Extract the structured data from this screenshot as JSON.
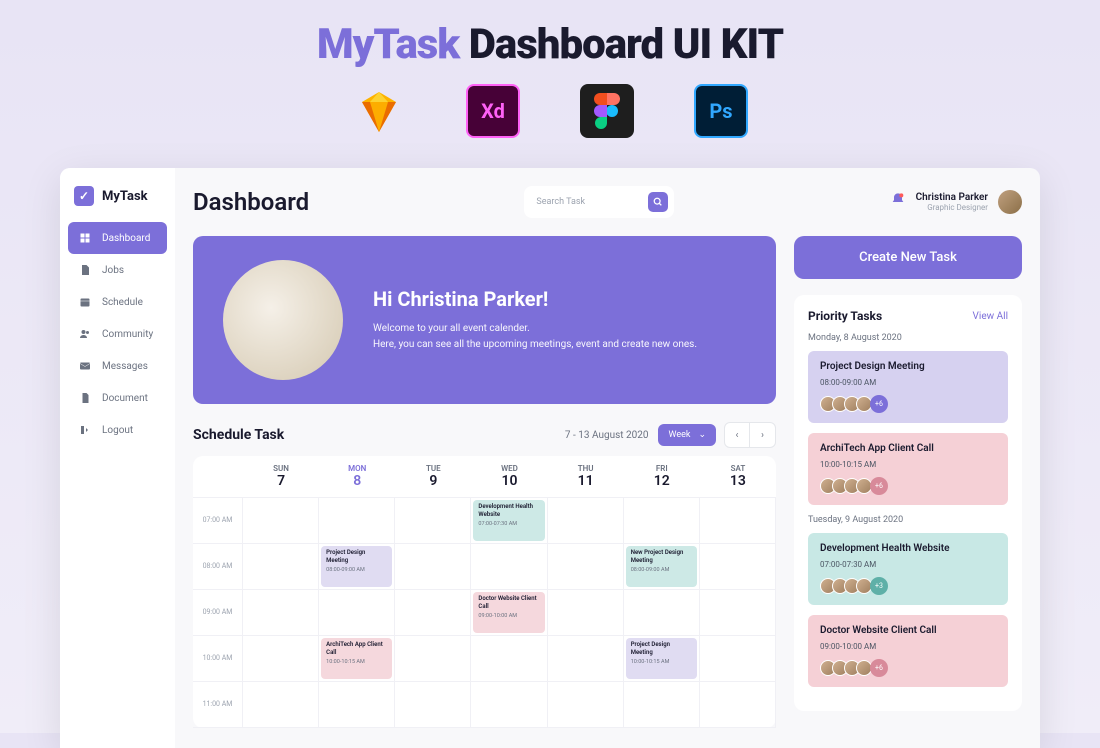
{
  "promo": {
    "brand": "MyTask",
    "rest": " Dashboard UI KIT"
  },
  "app": {
    "name": "MyTask"
  },
  "sidebar": {
    "items": [
      {
        "label": "Dashboard",
        "icon": "grid",
        "active": true
      },
      {
        "label": "Jobs",
        "icon": "file"
      },
      {
        "label": "Schedule",
        "icon": "calendar"
      },
      {
        "label": "Community",
        "icon": "users"
      },
      {
        "label": "Messages",
        "icon": "mail"
      },
      {
        "label": "Document",
        "icon": "doc"
      },
      {
        "label": "Logout",
        "icon": "logout"
      }
    ]
  },
  "header": {
    "title": "Dashboard",
    "search_placeholder": "Search Task",
    "user": {
      "name": "Christina Parker",
      "role": "Graphic Designer"
    }
  },
  "welcome": {
    "greeting": "Hi Christina Parker!",
    "line1": "Welcome to your all event calender.",
    "line2": "Here, you can see all the upcoming meetings, event and create new ones."
  },
  "create_button": "Create New Task",
  "priority": {
    "title": "Priority Tasks",
    "view_all": "View All",
    "groups": [
      {
        "date": "Monday, 8 August 2020",
        "tasks": [
          {
            "title": "Project Design Meeting",
            "time": "08:00-09:00 AM",
            "more": "+6",
            "color": "purple"
          },
          {
            "title": "ArchiTech App Client Call",
            "time": "10:00-10:15 AM",
            "more": "+6",
            "color": "pink"
          }
        ]
      },
      {
        "date": "Tuesday, 9 August 2020",
        "tasks": [
          {
            "title": "Development Health Website",
            "time": "07:00-07:30 AM",
            "more": "+3",
            "color": "teal"
          },
          {
            "title": "Doctor Website Client Call",
            "time": "09:00-10:00 AM",
            "more": "+6",
            "color": "pink"
          }
        ]
      }
    ]
  },
  "schedule": {
    "title": "Schedule Task",
    "range": "7 - 13 August 2020",
    "selector": "Week",
    "days": [
      {
        "name": "SUN",
        "num": "7"
      },
      {
        "name": "MON",
        "num": "8",
        "active": true
      },
      {
        "name": "TUE",
        "num": "9"
      },
      {
        "name": "WED",
        "num": "10"
      },
      {
        "name": "THU",
        "num": "11"
      },
      {
        "name": "FRI",
        "num": "12"
      },
      {
        "name": "SAT",
        "num": "13"
      }
    ],
    "hours": [
      "07:00 AM",
      "08:00 AM",
      "09:00 AM",
      "10:00 AM",
      "11:00 AM"
    ],
    "events": [
      {
        "row": 0,
        "col": 3,
        "title": "Development Health Website",
        "time": "07:00-07:30 AM",
        "color": "teal"
      },
      {
        "row": 1,
        "col": 1,
        "title": "Project Design Meeting",
        "time": "08:00-09:00 AM",
        "color": "purple"
      },
      {
        "row": 1,
        "col": 5,
        "title": "New Project Design Meeting",
        "time": "08:00-09:00 AM",
        "color": "teal"
      },
      {
        "row": 2,
        "col": 3,
        "title": "Doctor Website Client Call",
        "time": "09:00-10:00 AM",
        "color": "pink"
      },
      {
        "row": 3,
        "col": 1,
        "title": "ArchiTech App Client Call",
        "time": "10:00-10:15 AM",
        "color": "pink"
      },
      {
        "row": 3,
        "col": 5,
        "title": "Project Design Meeting",
        "time": "10:00-10:15 AM",
        "color": "purple"
      }
    ]
  },
  "colors": {
    "purple_more": "#7c6fd9",
    "pink_more": "#d88a9a",
    "teal_more": "#5fb0a8"
  }
}
